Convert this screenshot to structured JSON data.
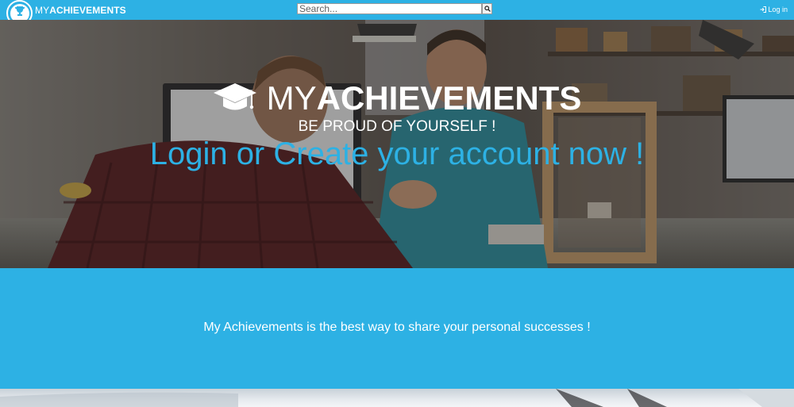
{
  "navbar": {
    "brand_my": "MY",
    "brand_achievements": "ACHIEVEMENTS",
    "search_placeholder": "Search...",
    "login_label": "Log in"
  },
  "hero": {
    "title_my": "MY",
    "title_achievements": "ACHIEVEMENTS",
    "tagline": "BE PROUD OF YOURSELF !",
    "cta": "Login or Create your account now !"
  },
  "band": {
    "text": "My Achievements is the best way to share your personal successes !"
  },
  "colors": {
    "accent": "#2db1e4",
    "text_on_accent": "#ffffff"
  },
  "icons": {
    "brand": "trophy-icon",
    "search": "search-icon",
    "login": "sign-in-icon",
    "title": "graduation-cap-icon"
  }
}
